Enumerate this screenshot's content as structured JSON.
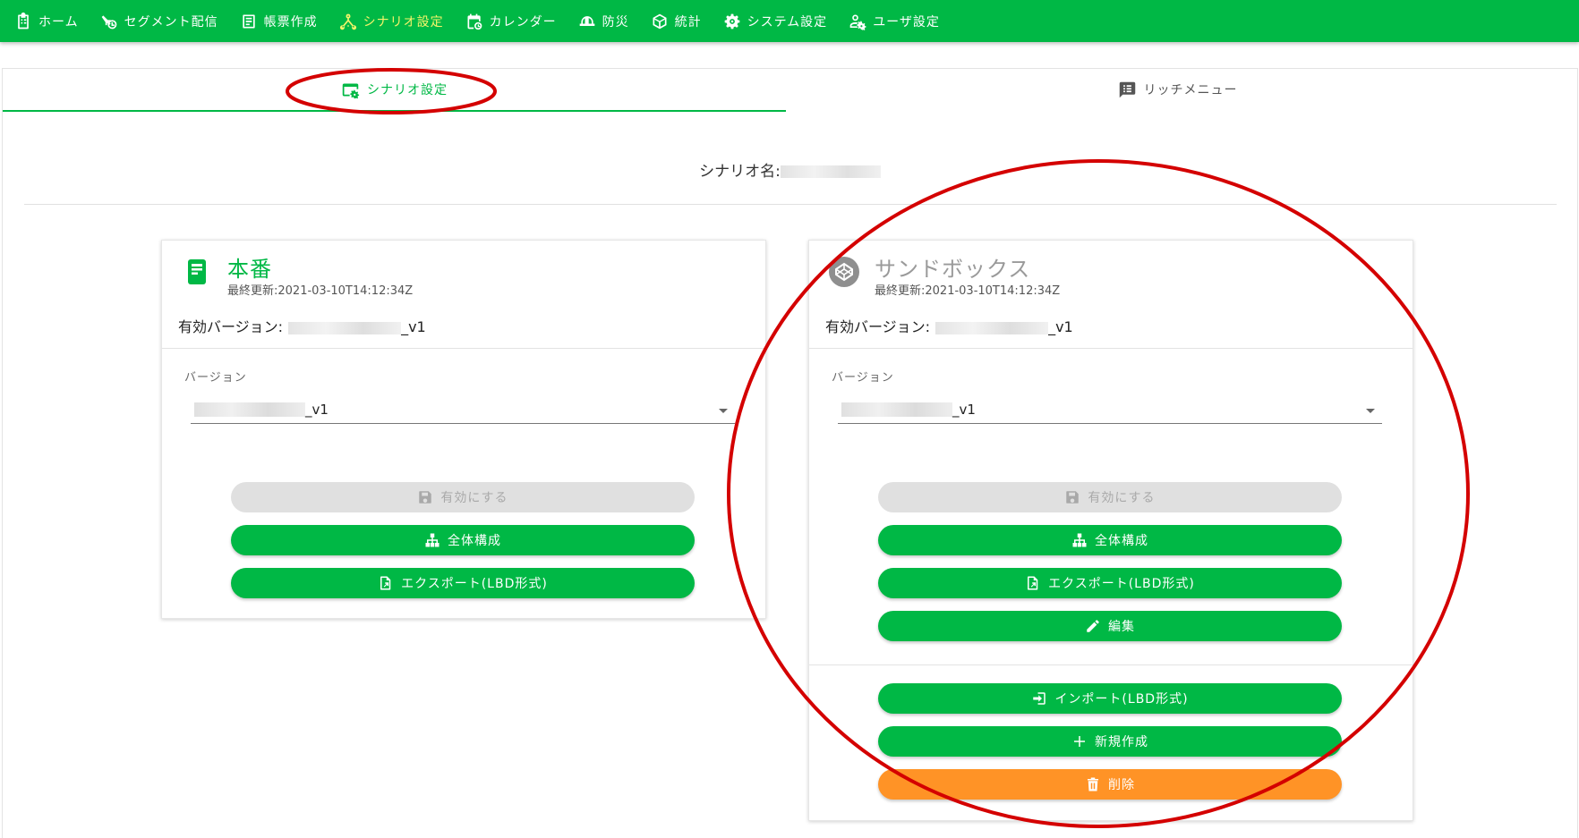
{
  "nav": {
    "items": [
      {
        "label": "ホーム",
        "icon": "clipboard-icon"
      },
      {
        "label": "セグメント配信",
        "icon": "segment-send-icon"
      },
      {
        "label": "帳票作成",
        "icon": "form-icon"
      },
      {
        "label": "シナリオ設定",
        "icon": "scenario-tree-icon",
        "active": true
      },
      {
        "label": "カレンダー",
        "icon": "calendar-icon"
      },
      {
        "label": "防災",
        "icon": "disaster-helmet-icon"
      },
      {
        "label": "統計",
        "icon": "cube-icon"
      },
      {
        "label": "システム設定",
        "icon": "gear-icon"
      },
      {
        "label": "ユーザ設定",
        "icon": "user-gear-icon"
      }
    ]
  },
  "tabs": {
    "scenario": "シナリオ設定",
    "rich_menu": "リッチメニュー"
  },
  "scenario_name_label": "シナリオ名:",
  "production": {
    "title": "本番",
    "updated": "最終更新:2021-03-10T14:12:34Z",
    "active_version_label": "有効バージョン:",
    "active_version_suffix": "_v1",
    "version_label": "バージョン",
    "version_value": "_v1",
    "buttons": {
      "activate": "有効にする",
      "overview": "全体構成",
      "export": "エクスポート(LBD形式)"
    }
  },
  "sandbox": {
    "title": "サンドボックス",
    "updated": "最終更新:2021-03-10T14:12:34Z",
    "active_version_label": "有効バージョン:",
    "active_version_suffix": "_v1",
    "version_label": "バージョン",
    "version_value": "_v1",
    "buttons": {
      "activate": "有効にする",
      "overview": "全体構成",
      "export": "エクスポート(LBD形式)",
      "edit": "編集",
      "import": "インポート(LBD形式)",
      "create": "新規作成",
      "delete": "削除"
    }
  },
  "colors": {
    "brand_green": "#00b845",
    "active_nav": "#f4f46a",
    "danger_orange": "#ff9326",
    "annotation_red": "#d40000"
  }
}
